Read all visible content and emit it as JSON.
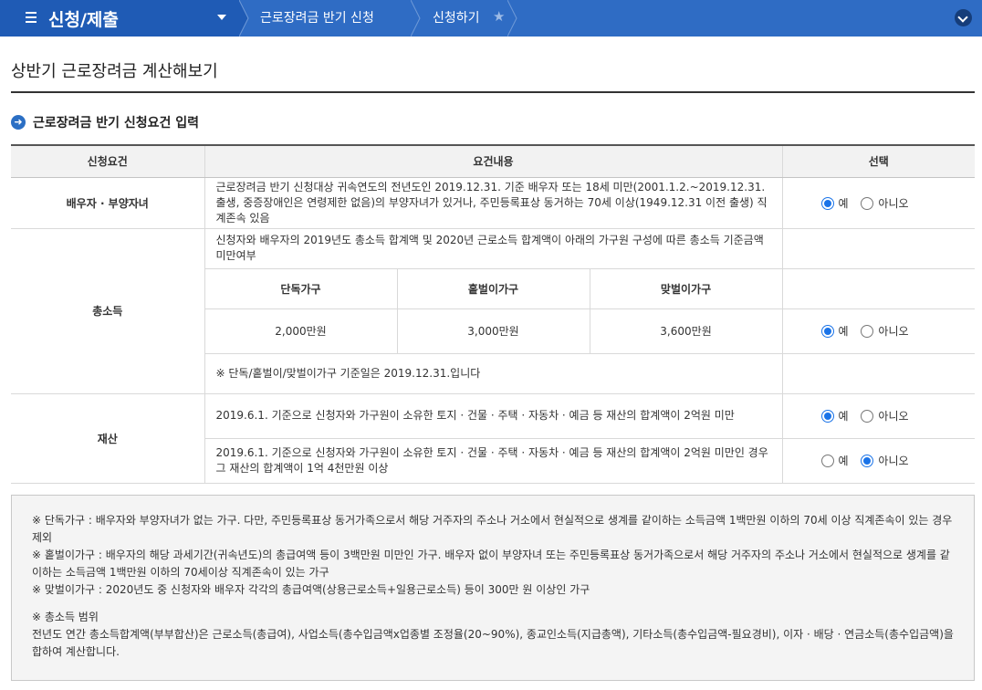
{
  "nav": {
    "menu_title": "신청/제출",
    "crumb1": "근로장려금 반기 신청",
    "crumb2": "신청하기"
  },
  "page_title": "상반기 근로장려금 계산해보기",
  "section_title": "근로장려금 반기 신청요건 입력",
  "table": {
    "headers": [
      "신청요건",
      "요건내용",
      "선택"
    ],
    "spouse": {
      "label": "배우자 · 부양자녀",
      "text": "근로장려금 반기 신청대상 귀속연도의 전년도인 2019.12.31. 기준 배우자 또는 18세 미만(2001.1.2.~2019.12.31. 출생, 중증장애인은 연령제한 없음)의 부양자녀가 있거나, 주민등록표상 동거하는 70세 이상(1949.12.31 이전 출생) 직계존속 있음",
      "selected": "yes"
    },
    "income": {
      "label": "총소득",
      "text": "신청자와 배우자의 2019년도 총소득 합계액 및 2020년 근로소득 합계액이 아래의 가구원 구성에 따른 총소득 기준금액 미만여부",
      "sub_headers": [
        "단독가구",
        "홑벌이가구",
        "맞벌이가구"
      ],
      "sub_values": [
        "2,000만원",
        "3,000만원",
        "3,600만원"
      ],
      "note": "※ 단독/홑벌이/맞벌이가구 기준일은 2019.12.31.입니다",
      "selected": "yes"
    },
    "property": {
      "label": "재산",
      "row1_text": "2019.6.1. 기준으로 신청자와 가구원이 소유한 토지 · 건물 · 주택 · 자동차 · 예금 등 재산의 합계액이 2억원 미만",
      "row1_selected": "yes",
      "row2_text": "2019.6.1. 기준으로 신청자와 가구원이 소유한 토지 · 건물 · 주택 · 자동차 · 예금 등 재산의 합계액이 2억원 미만인 경우 그 재산의 합계액이 1억 4천만원 이상",
      "row2_selected": "no"
    },
    "option_yes": "예",
    "option_no": "아니오"
  },
  "notes": {
    "line1": "※ 단독가구 : 배우자와 부양자녀가 없는 가구. 다만, 주민등록표상 동거가족으로서 해당 거주자의 주소나 거소에서 현실적으로 생계를 같이하는 소득금액 1백만원 이하의 70세 이상 직계존속이 있는 경우 제외",
    "line2": "※ 홑벌이가구 : 배우자의 해당 과세기간(귀속년도)의 총급여액 등이 3백만원 미만인 가구. 배우자 없이 부양자녀 또는 주민등록표상 동거가족으로서 해당 거주자의 주소나 거소에서 현실적으로 생계를 같이하는 소득금액 1백만원 이하의 70세이상 직계존속이 있는 가구",
    "line3": "※ 맞벌이가구 : 2020년도 중 신청자와 배우자 각각의 총급여액(상용근로소득+일용근로소득) 등이 300만 원 이상인 가구",
    "scope_title": "※ 총소득 범위",
    "scope_text": "전년도 연간 총소득합계액(부부합산)은 근로소득(총급여), 사업소득(총수입금액x업종별 조정율(20~90%), 종교인소득(지급총액), 기타소득(총수입금액-필요경비), 이자 · 배당 · 연금소득(총수입금액)을 합하여 계산합니다."
  }
}
